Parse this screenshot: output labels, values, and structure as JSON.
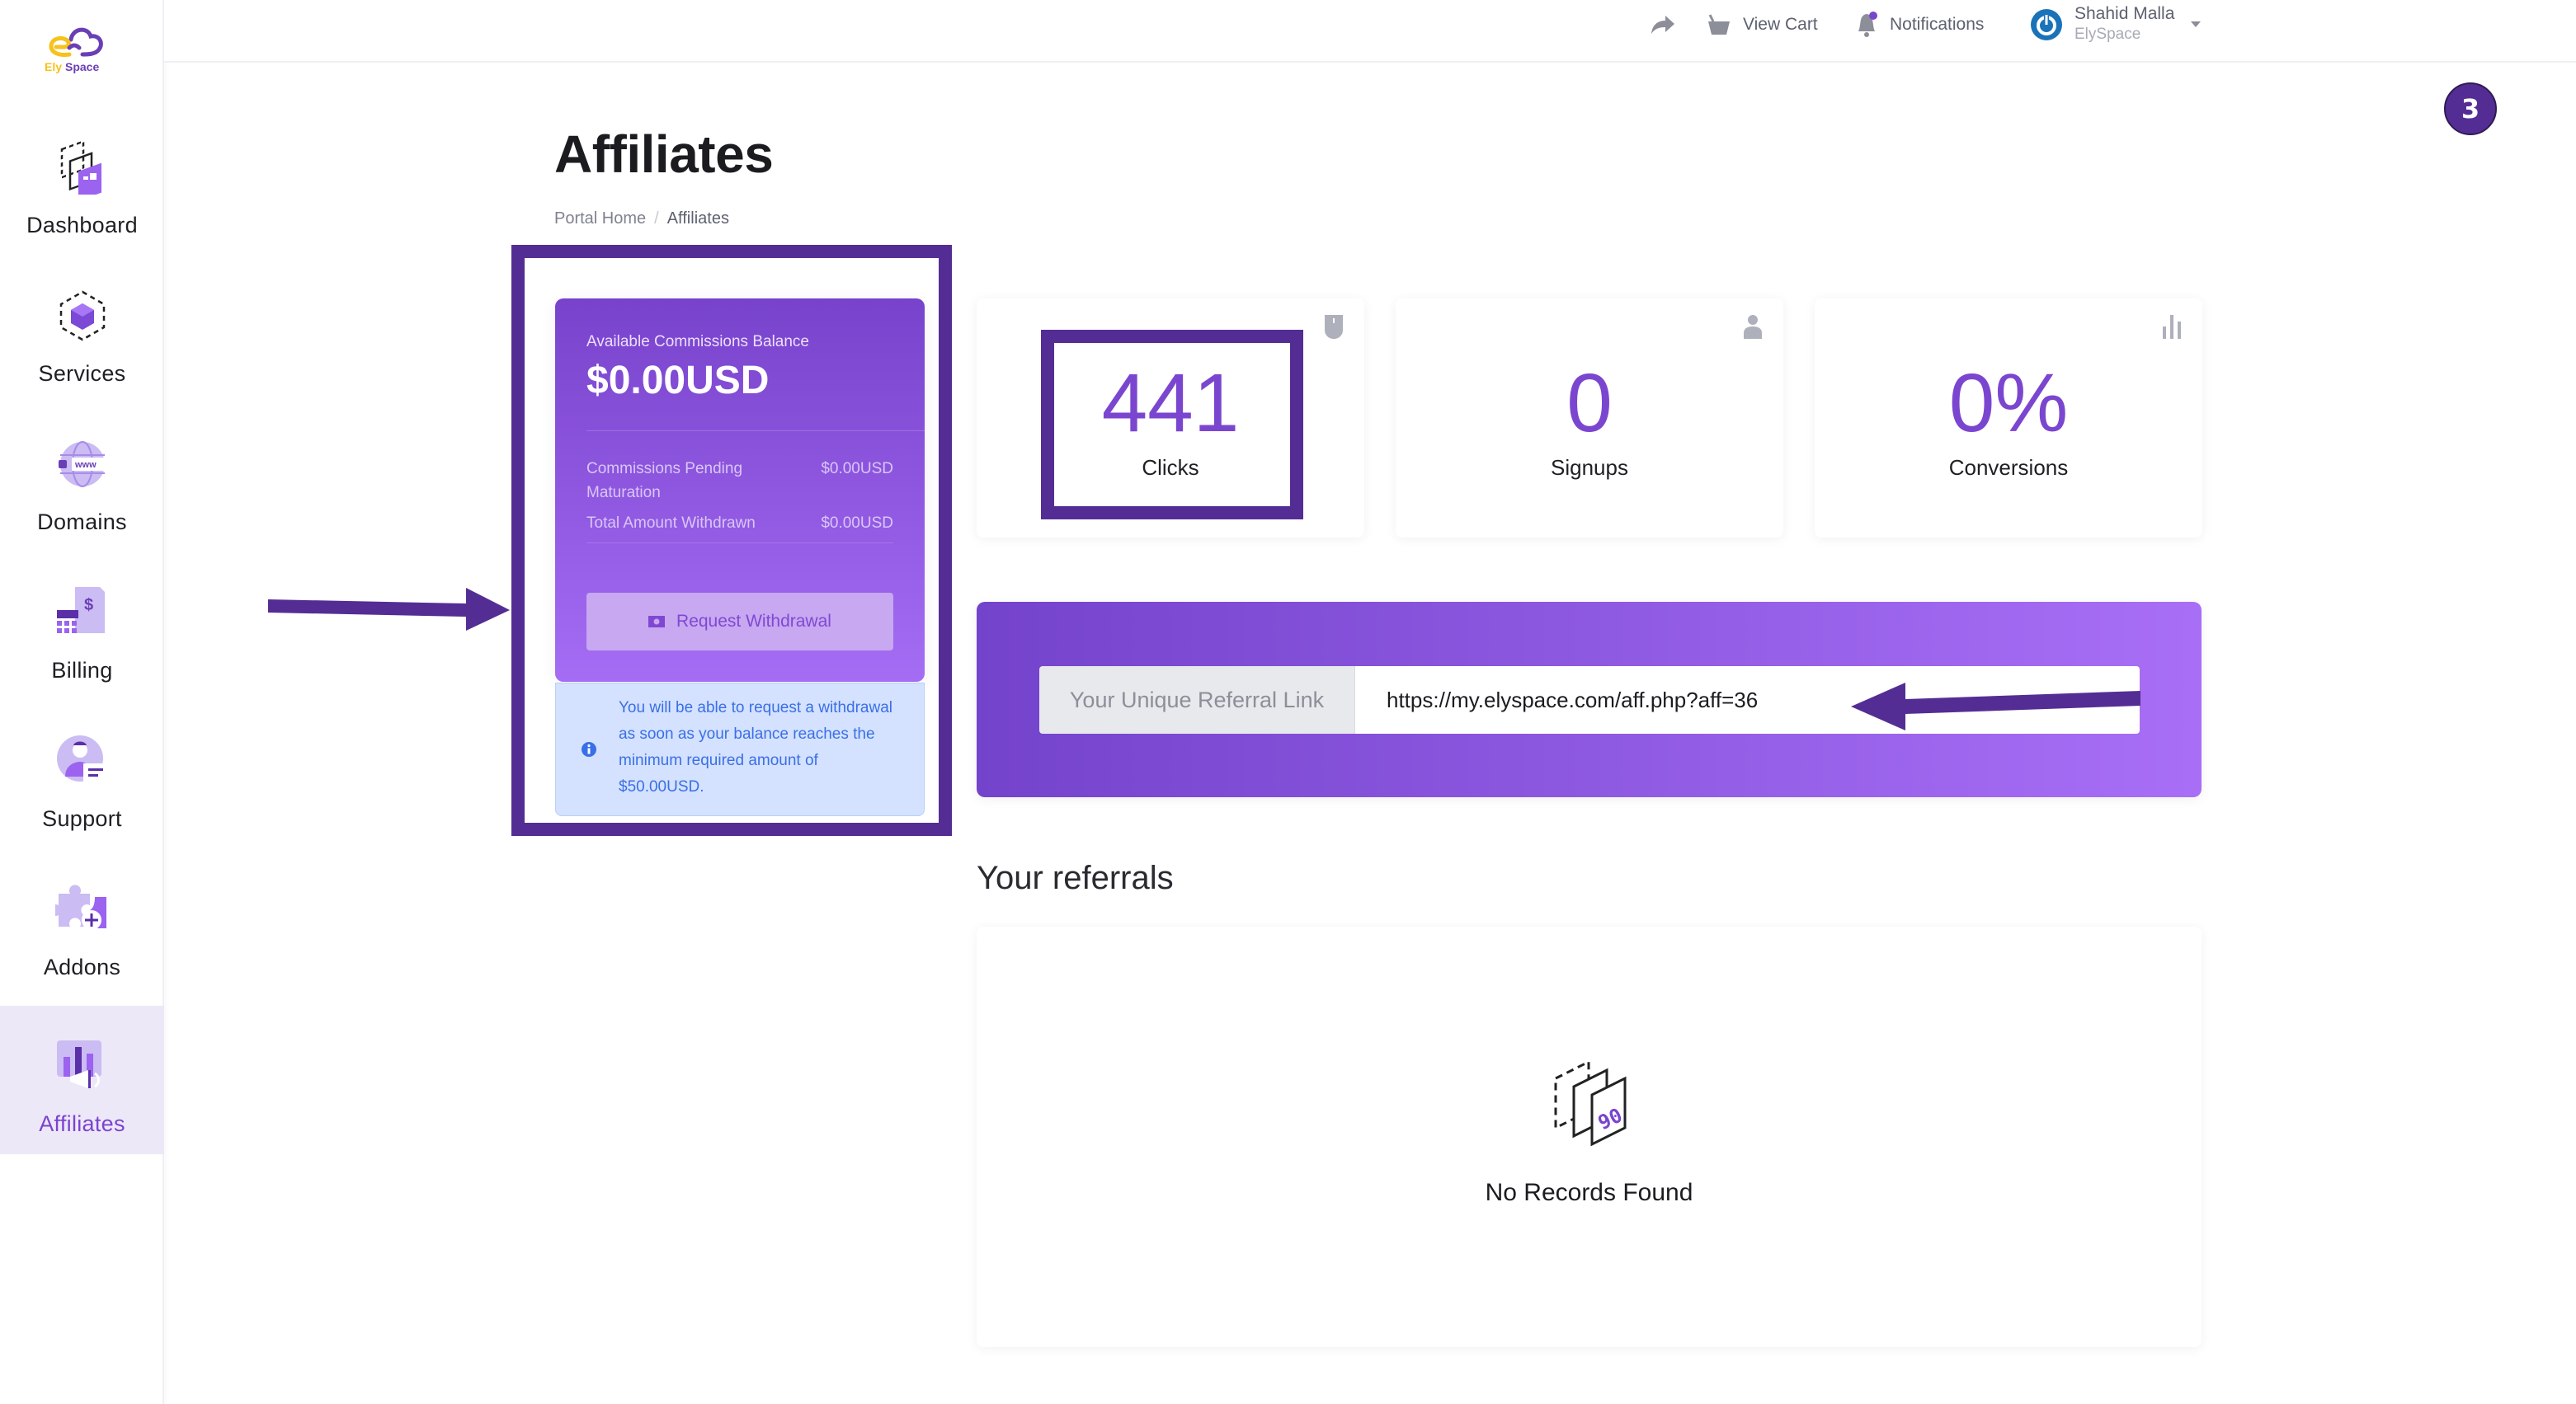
{
  "app": {
    "brand": "ElySpace",
    "brand_accent": "#7a44cf",
    "brand_yellow": "#f6c21c"
  },
  "sidebar": {
    "items": [
      {
        "label": "Dashboard",
        "icon": "dashboard-icon",
        "active": false
      },
      {
        "label": "Services",
        "icon": "services-cube-icon",
        "active": false
      },
      {
        "label": "Domains",
        "icon": "domains-globe-icon",
        "active": false
      },
      {
        "label": "Billing",
        "icon": "billing-invoice-icon",
        "active": false
      },
      {
        "label": "Support",
        "icon": "support-agent-icon",
        "active": false
      },
      {
        "label": "Addons",
        "icon": "addons-puzzle-icon",
        "active": false
      },
      {
        "label": "Affiliates",
        "icon": "affiliates-megaphone-icon",
        "active": true
      }
    ]
  },
  "topbar": {
    "share_icon": "share-arrow-icon",
    "view_cart": "View Cart",
    "notifications": "Notifications",
    "user_name": "Shahid Malla",
    "user_org": "ElySpace"
  },
  "annotation": {
    "step_number": "3",
    "highlight_color": "#542d94"
  },
  "page": {
    "title": "Affiliates",
    "breadcrumb": [
      "Portal Home",
      "Affiliates"
    ]
  },
  "balance": {
    "label": "Available Commissions Balance",
    "amount": "$0.00USD",
    "rows": [
      {
        "key": "Commissions Pending Maturation",
        "value": "$0.00USD"
      },
      {
        "key": "Total Amount Withdrawn",
        "value": "$0.00USD"
      }
    ],
    "withdraw_button": "Request Withdrawal",
    "info": "You will be able to request a withdrawal as soon as your balance reaches the minimum required amount of $50.00USD."
  },
  "stats": [
    {
      "value": "441",
      "label": "Clicks",
      "icon": "mouse-icon"
    },
    {
      "value": "0",
      "label": "Signups",
      "icon": "user-icon"
    },
    {
      "value": "0%",
      "label": "Conversions",
      "icon": "bar-chart-icon"
    }
  ],
  "referral": {
    "addon_label": "Your Unique Referral Link",
    "link": "https://my.elyspace.com/aff.php?aff=36"
  },
  "referrals": {
    "title": "Your referrals",
    "empty_text": "No Records Found"
  }
}
